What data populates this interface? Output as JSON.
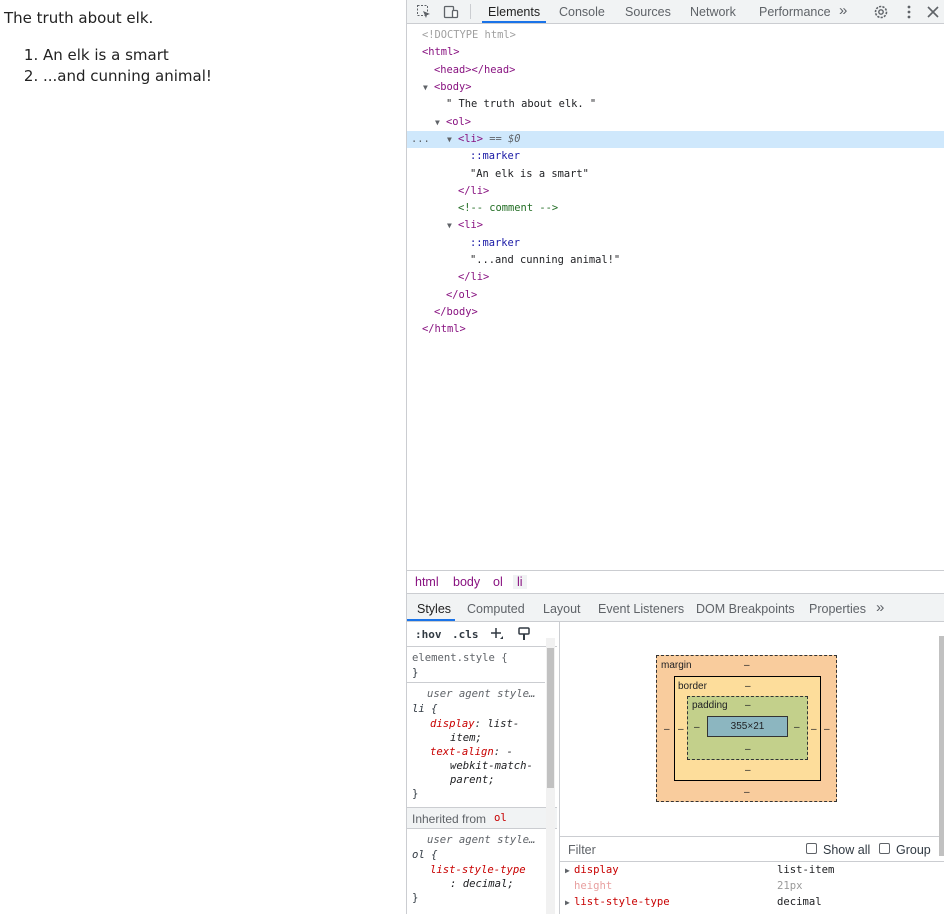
{
  "page": {
    "title": "The truth about elk.",
    "items": [
      "An elk is a smart",
      "...and cunning animal!"
    ]
  },
  "devtools": {
    "tabs": [
      "Elements",
      "Console",
      "Sources",
      "Network",
      "Performance"
    ],
    "more_tabs": "»",
    "icons": [
      "inspect-element-icon",
      "device-toolbar-icon",
      "settings-icon",
      "more-options-icon",
      "close-icon"
    ],
    "dom": {
      "doctype": "<!DOCTYPE html>",
      "html_open": "<html>",
      "head": "<head></head>",
      "body_open": "<body>",
      "body_text": "\" The truth about elk. \"",
      "ol_open": "<ol>",
      "li_open": "<li>",
      "li_eq": " == $0",
      "marker": "::marker",
      "li1_text": "\"An elk is a smart\"",
      "li_close": "</li>",
      "comment": "<!-- comment -->",
      "li2_text": "\"...and cunning animal!\"",
      "ol_close": "</ol>",
      "body_close": "</body>",
      "html_close": "</html>",
      "gutter": "..."
    },
    "breadcrumbs": [
      "html",
      "body",
      "ol",
      "li"
    ],
    "subtabs": [
      "Styles",
      "Computed",
      "Layout",
      "Event Listeners",
      "DOM Breakpoints",
      "Properties"
    ],
    "styles": {
      "hov": ":hov",
      "cls": ".cls",
      "element_style": "element.style {",
      "close_brace": "}",
      "ua_label": "user agent style…",
      "li_selector": "li {",
      "display_prop": "display",
      "display_val": "list-",
      "display_val2": "item;",
      "textalign_prop": "text-align",
      "textalign_val": "-",
      "textalign_val2": "webkit-match-",
      "textalign_val3": "parent;",
      "inherited_label": "Inherited from",
      "inherited_from": "ol",
      "ol_selector": "ol {",
      "lst_prop": "list-style-type",
      "lst_val": ": decimal;"
    },
    "boxmodel": {
      "margin": "margin",
      "border": "border",
      "padding": "padding",
      "dash": "–",
      "content": "355×21"
    },
    "computed": {
      "filter_placeholder": "Filter",
      "show_all": "Show all",
      "group": "Group",
      "rows": [
        {
          "prop": "display",
          "value": "list-item"
        },
        {
          "prop": "height",
          "value": "21px"
        },
        {
          "prop": "list-style-type",
          "value": "decimal"
        }
      ]
    },
    "colors": {
      "accent": "#1a73e8",
      "tag": "#881280",
      "selected_row": "#cfe8fc"
    }
  }
}
